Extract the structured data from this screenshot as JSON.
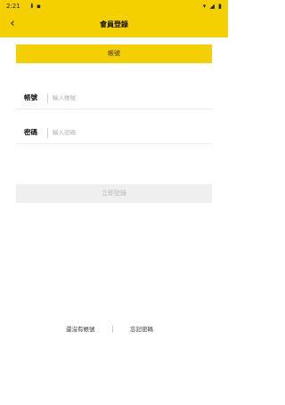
{
  "status_bar": {
    "time": "2:21",
    "notification_icons": "⬇ ▪",
    "system_icons": "▾ ◢ ▮"
  },
  "header": {
    "back_icon": "chevron-left-icon",
    "back_glyph": "‹",
    "title": "會員登錄"
  },
  "login_tab": {
    "label": "帳號"
  },
  "form": {
    "account": {
      "label": "帳號",
      "value": "",
      "placeholder": "輸入帳號"
    },
    "password": {
      "label": "密碼",
      "value": "",
      "placeholder": "輸入密碼"
    }
  },
  "submit": {
    "label": "立即登錄"
  },
  "links": {
    "register": "還沒有帳號",
    "forgot_password": "忘記密碼"
  },
  "colors": {
    "accent": "#f5d000",
    "disabled_button_bg": "#efefef",
    "disabled_button_text": "#b8b8b8",
    "placeholder_text": "#b0b0b0"
  }
}
